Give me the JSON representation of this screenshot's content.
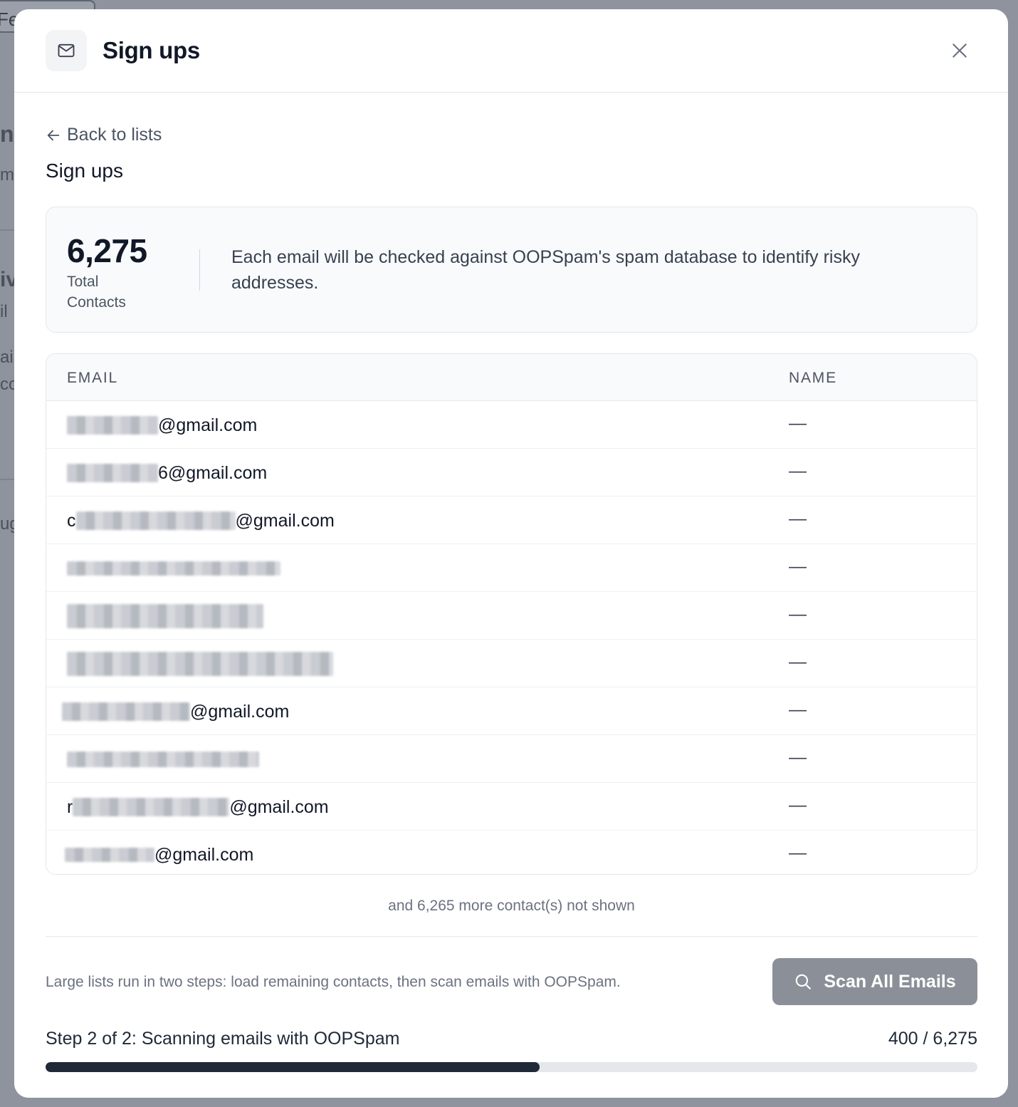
{
  "background": {
    "tab_fragment": "Fe",
    "fragments": [
      "nS",
      "m",
      "iv",
      "il",
      "ail",
      "co",
      "ug"
    ]
  },
  "modal": {
    "title": "Sign ups",
    "icon": "envelope-icon",
    "close_icon": "close-icon"
  },
  "nav": {
    "back_label": "Back to lists",
    "back_icon": "arrow-left-icon"
  },
  "section_title": "Sign ups",
  "summary": {
    "total": "6,275",
    "total_label": "Total Contacts",
    "description": "Each email will be checked against OOPSpam's spam database to identify risky addresses."
  },
  "table": {
    "columns": [
      "EMAIL",
      "NAME"
    ],
    "rows": [
      {
        "email_prefix": "",
        "email_suffix": "@gmail.com",
        "name": "—"
      },
      {
        "email_prefix": "",
        "email_suffix": "6@gmail.com",
        "name": "—"
      },
      {
        "email_prefix": "c",
        "email_suffix": "@gmail.com",
        "name": "—"
      },
      {
        "email_prefix": "",
        "email_suffix": "",
        "name": "—"
      },
      {
        "email_prefix": "",
        "email_suffix": "",
        "name": "—"
      },
      {
        "email_prefix": "",
        "email_suffix": "",
        "name": "—"
      },
      {
        "email_prefix": "",
        "email_suffix": "@gmail.com",
        "name": "—"
      },
      {
        "email_prefix": "",
        "email_suffix": "",
        "name": "—"
      },
      {
        "email_prefix": "r",
        "email_suffix": "@gmail.com",
        "name": "—"
      },
      {
        "email_prefix": "",
        "email_suffix": "@gmail.com",
        "name": "—"
      }
    ]
  },
  "more_contacts_text": "and 6,265 more contact(s) not shown",
  "footer": {
    "note": "Large lists run in two steps: load remaining contacts, then scan emails with OOPSpam.",
    "scan_button_label": "Scan All Emails",
    "scan_icon": "search-icon"
  },
  "progress": {
    "step_label": "Step 2 of 2: Scanning emails with OOPSpam",
    "count_label": "400 / 6,275",
    "percent": 53
  },
  "colors": {
    "overlay": "#8e939e",
    "modal_bg": "#ffffff",
    "primary_text": "#111827",
    "progress_fill": "#1f2937",
    "button_disabled": "#8b9098"
  }
}
